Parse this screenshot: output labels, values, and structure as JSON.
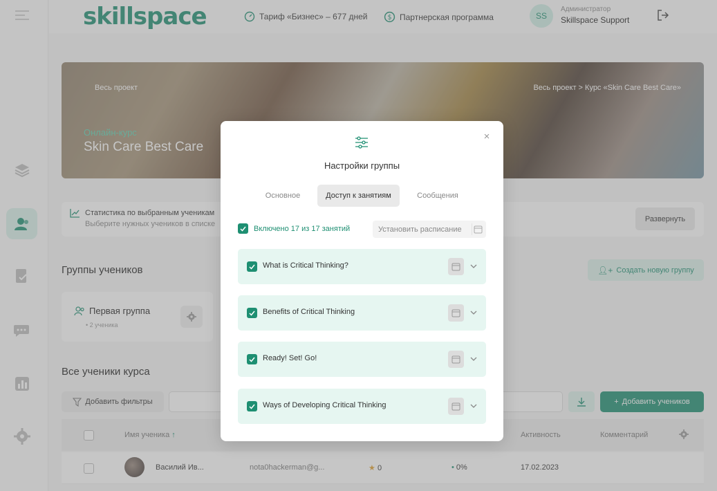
{
  "header": {
    "logo": "skillspace",
    "tariff": "Тариф «Бизнес» – 677 дней",
    "partner": "Партнерская программа",
    "avatar_initials": "SS",
    "role": "Администратор",
    "user": "Skillspace Support"
  },
  "banner": {
    "all_project": "Весь проект",
    "breadcrumb": "Весь проект  >  Курс «Skin Care Best Care»",
    "subtitle": "Онлайн-курс",
    "title": "Skin Care Best Care"
  },
  "stats": {
    "line1": "Статистика по выбранным ученикам",
    "line2": "Выберите нужных учеников в списке",
    "expand_label": "Развернуть"
  },
  "groups": {
    "heading": "Группы учеников",
    "create_label": "Создать новую группу",
    "items": [
      {
        "name": "Первая группа",
        "count": "2 ученика"
      }
    ]
  },
  "students": {
    "heading": "Все ученики курса",
    "filter_label": "Добавить фильтры",
    "add_label": "Добавить учеников",
    "columns": {
      "name": "Имя ученика",
      "activity": "Активность",
      "comment": "Комментарий"
    },
    "rows": [
      {
        "name": "Василий Ив...",
        "email": "nota0hackerman@g...",
        "points": "0",
        "progress": "0%",
        "activity": "17.02.2023"
      }
    ]
  },
  "modal": {
    "title": "Настройки группы",
    "tabs": [
      "Основное",
      "Доступ к занятиям",
      "Сообщения"
    ],
    "active_tab": 1,
    "included": "Включено 17 из 17 занятий",
    "schedule_label": "Установить расписание",
    "lessons": [
      {
        "name": "What is Critical Thinking?",
        "checked": true
      },
      {
        "name": "Benefits of Critical Thinking",
        "checked": true
      },
      {
        "name": "Ready! Set! Go!",
        "checked": true
      },
      {
        "name": "Ways of Developing Critical Thinking",
        "checked": true
      }
    ]
  },
  "colors": {
    "accent": "#1e8f72",
    "accent_light": "#e6f6f1"
  }
}
